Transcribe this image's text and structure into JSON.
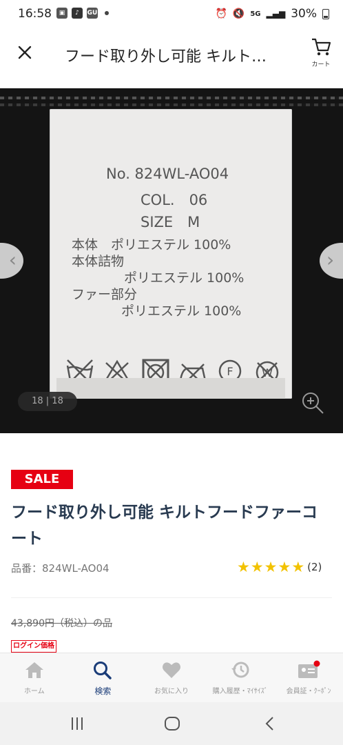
{
  "status_bar": {
    "time": "16:58",
    "app_icon_label": "GU",
    "battery": "30%"
  },
  "header": {
    "close_icon": "close-icon",
    "title": "フード取り外し可能 キルト…",
    "cart_label": "カート"
  },
  "gallery": {
    "tag_lines": {
      "no": "No. 824WL-AO04",
      "col": "COL.　06",
      "size": "SIZE　M",
      "l1": "本体　ポリエステル 100%",
      "l2": "本体詰物",
      "l3": "ポリエステル 100%",
      "l4": "ファー部分",
      "l5": "ポリエステル 100%"
    },
    "counter": "18 | 18"
  },
  "product": {
    "sale_badge": "SALE",
    "name": "フード取り外し可能 キルトフードファーコート",
    "code": "品番：824WL-AO04",
    "rating": 5,
    "review_count": "(2)",
    "old_price": "43,890円（税込）の品",
    "login_price_label": "ログイン価格"
  },
  "bottom_nav": [
    {
      "label": "ホーム",
      "icon": "home-icon"
    },
    {
      "label": "検索",
      "icon": "search-icon",
      "active": true
    },
    {
      "label": "お気に入り",
      "icon": "heart-icon"
    },
    {
      "label": "購入履歴・ﾏｲｻｲｽﾞ",
      "icon": "history-icon"
    },
    {
      "label": "会員証・ｸｰﾎﾟﾝ",
      "icon": "member-card-icon"
    }
  ],
  "colors": {
    "sale_red": "#e60012",
    "title_navy": "#283a50",
    "star": "#f2c200",
    "nav_active": "#1a3c78"
  }
}
